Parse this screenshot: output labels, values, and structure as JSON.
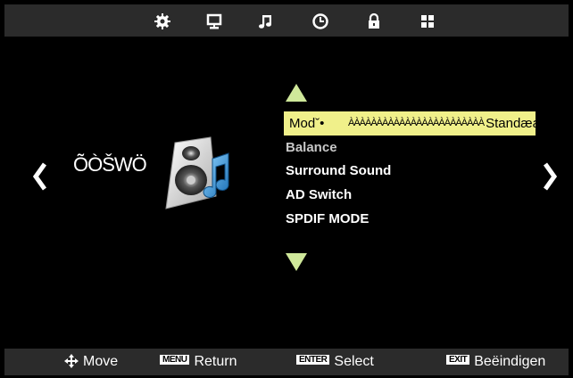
{
  "topbar": {
    "icons": [
      "picture-settings-icon",
      "display-icon",
      "music-note-icon",
      "clock-icon",
      "lock-icon",
      "grid-icon"
    ]
  },
  "section": {
    "title": "ÕÒŠWÖ",
    "icon": "speaker-music-icon"
  },
  "menu": {
    "items": [
      {
        "label": "Modˇ•",
        "filler": "ÀÀÀÀÀÀÀÀÀÀÀÀÀÀÀÀÀÀÀÀÀÀÀÀ",
        "value": "Standæard",
        "state": "selected"
      },
      {
        "label": "Balance",
        "state": "disabled"
      },
      {
        "label": "Surround Sound",
        "state": "normal"
      },
      {
        "label": "AD Switch",
        "state": "normal"
      },
      {
        "label": "SPDIF MODE",
        "state": "normal"
      }
    ]
  },
  "footer": {
    "move_label": "Move",
    "return_key": "MENU",
    "return_label": "Return",
    "select_key": "ENTER",
    "select_label": "Select",
    "exit_key": "EXIT",
    "exit_label": "Beëindigen"
  },
  "colors": {
    "highlight": "#f0f08a",
    "triangle": "#cfe89a",
    "bar": "#2b2b2b",
    "background": "#000000"
  }
}
